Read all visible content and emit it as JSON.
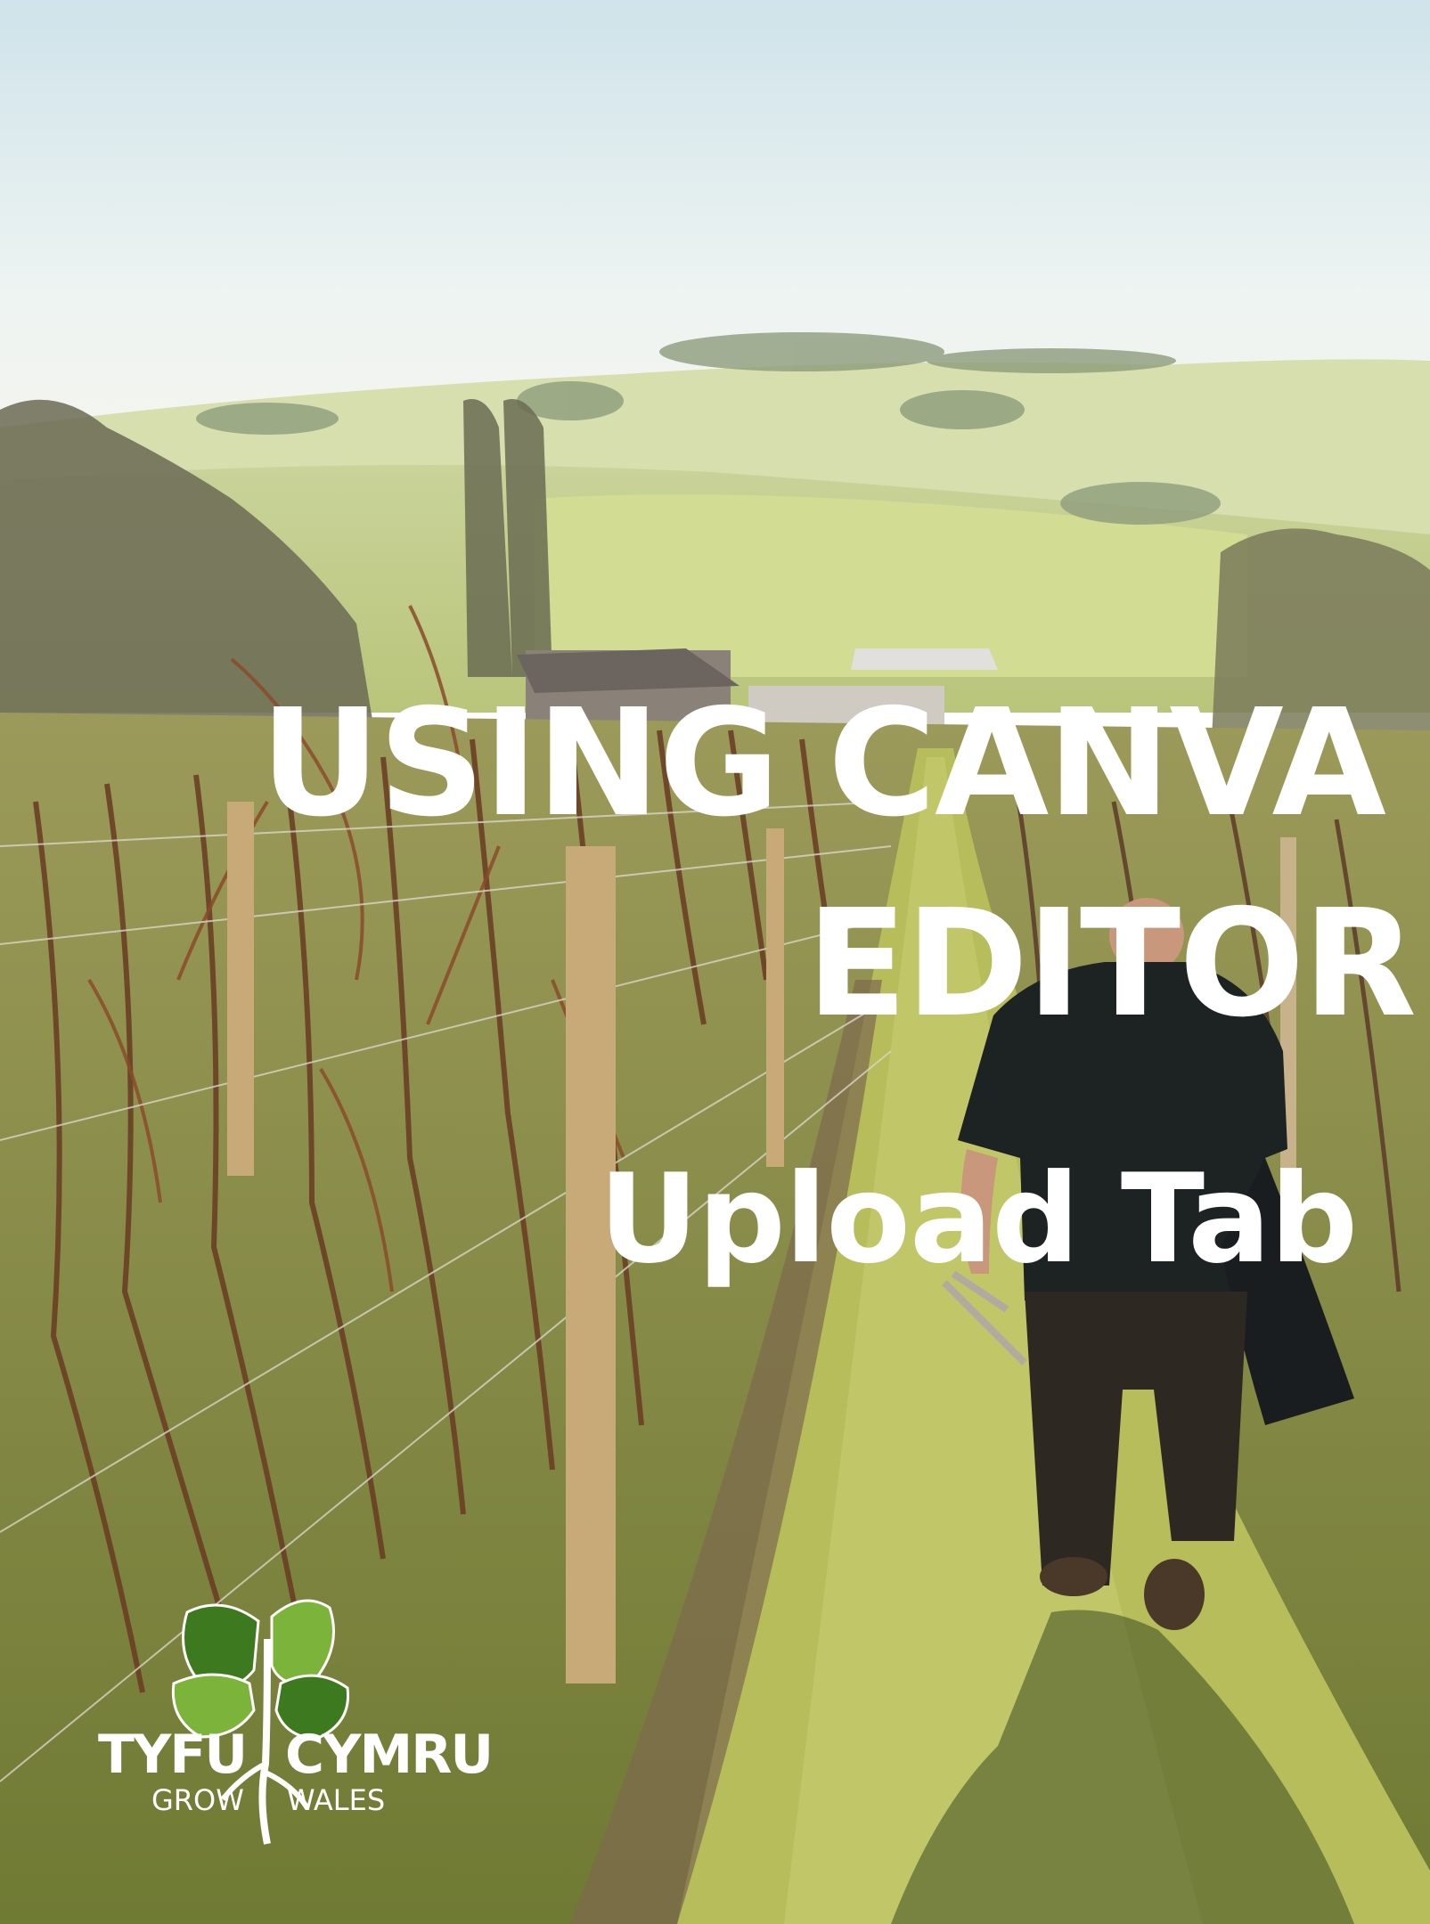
{
  "title": {
    "line1": "USING CANVA",
    "line2": "EDITOR"
  },
  "subtitle": "Upload Tab",
  "logo": {
    "word_left": "TYFU",
    "word_right": "CYMRU",
    "tagline_left": "GROW",
    "tagline_right": "WALES"
  },
  "colors": {
    "title_text": "#ffffff",
    "leaf_dark": "#3d7a1f",
    "leaf_light": "#7cb33a"
  }
}
